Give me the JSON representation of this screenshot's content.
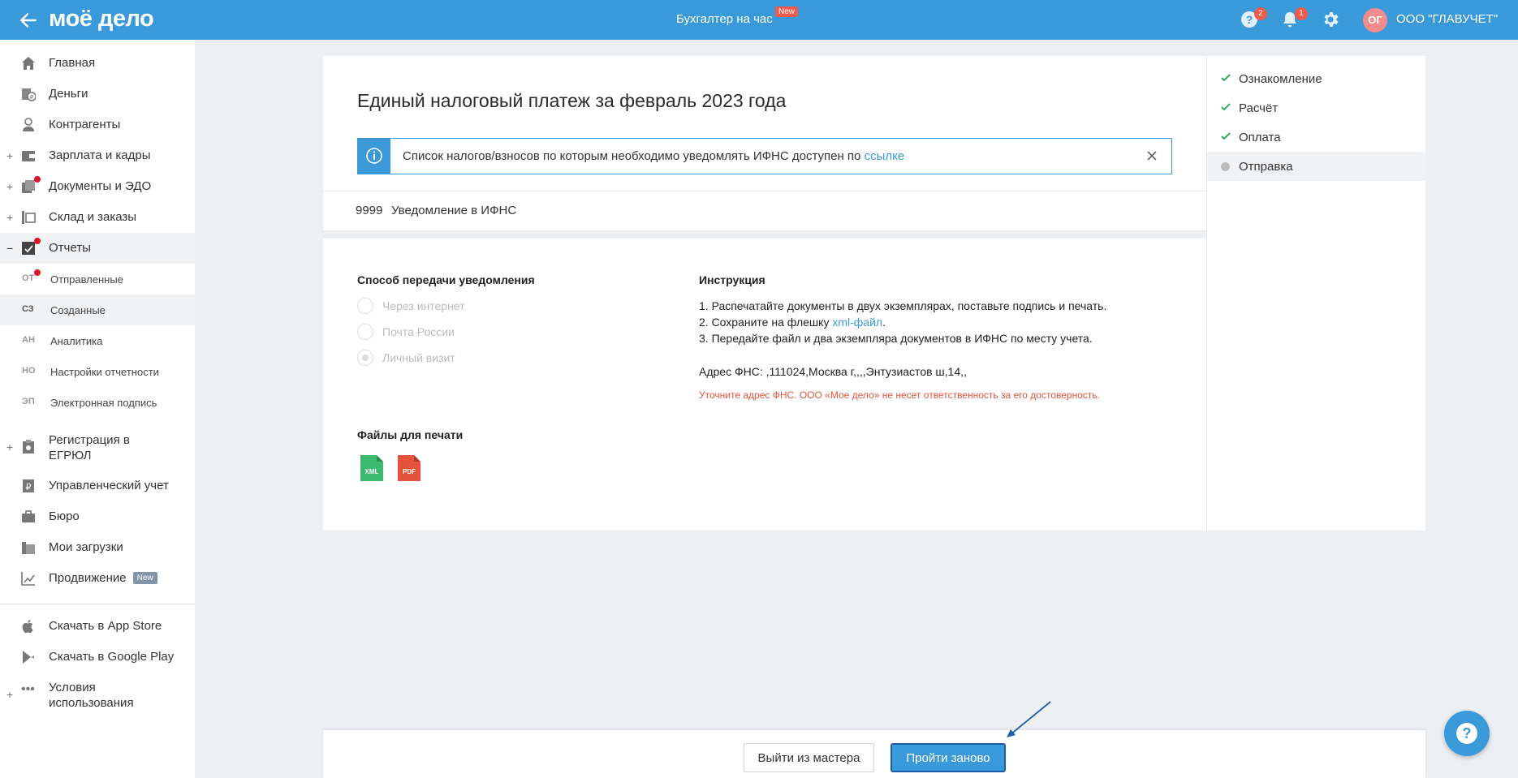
{
  "topbar": {
    "logo": "моё дело",
    "center_label": "Бухгалтер на час",
    "center_badge": "New",
    "help_count": "2",
    "notif_count": "1",
    "avatar_initials": "ОГ",
    "company": "ООО \"ГЛАВУЧЕТ\""
  },
  "sidebar": {
    "items": [
      {
        "label": "Главная"
      },
      {
        "label": "Деньги"
      },
      {
        "label": "Контрагенты"
      },
      {
        "label": "Зарплата и кадры"
      },
      {
        "label": "Документы и ЭДО"
      },
      {
        "label": "Склад и заказы"
      },
      {
        "label": "Отчеты"
      }
    ],
    "subitems": [
      {
        "abbr": "ОТ",
        "label": "Отправленные"
      },
      {
        "abbr": "СЗ",
        "label": "Созданные"
      },
      {
        "abbr": "АН",
        "label": "Аналитика"
      },
      {
        "abbr": "НО",
        "label": "Настройки отчетности"
      },
      {
        "abbr": "ЭП",
        "label": "Электронная подпись"
      }
    ],
    "items2": [
      {
        "label": "Регистрация в ЕГРЮЛ"
      },
      {
        "label": "Управленческий учет"
      },
      {
        "label": "Бюро"
      },
      {
        "label": "Мои загрузки"
      },
      {
        "label": "Продвижение",
        "badge": "New"
      }
    ],
    "items3": [
      {
        "label": "Скачать в App Store"
      },
      {
        "label": "Скачать в Google Play"
      },
      {
        "label": "Условия использования"
      }
    ]
  },
  "main": {
    "title": "Единый налоговый платеж за февраль 2023 года",
    "info_text": "Список налогов/взносов по которым необходимо уведомлять ИФНС доступен по ",
    "info_link": "ссылке",
    "code": "9999",
    "code_name": "Уведомление в ИФНС",
    "transfer_title": "Способ передачи уведомления",
    "transfer_options": [
      "Через интернет",
      "Почта России",
      "Личный визит"
    ],
    "files_title": "Файлы для печати",
    "file_xml": "XML",
    "file_pdf": "PDF",
    "instr_title": "Инструкция",
    "instr_1": "1. Распечатайте документы в двух экземплярах, поставьте подпись и печать.",
    "instr_2_pre": "2. Сохраните на флешку ",
    "instr_2_link": "xml-файл",
    "instr_2_post": ".",
    "instr_3": "3. Передайте файл и два экземпляра документов в ИФНС по месту учета.",
    "address": "Адрес ФНС: ,111024,Москва г,,,,Энтузиастов ш,14,,",
    "warning": "Уточните адрес ФНС. ООО «Мое дело» не несет ответственность за его достоверность."
  },
  "steps": [
    {
      "label": "Ознакомление",
      "done": true
    },
    {
      "label": "Расчёт",
      "done": true
    },
    {
      "label": "Оплата",
      "done": true
    },
    {
      "label": "Отправка",
      "done": false
    }
  ],
  "footer": {
    "exit_label": "Выйти из мастера",
    "restart_label": "Пройти заново"
  },
  "colors": {
    "accent": "#3a9ad9",
    "badge": "#f05a4a",
    "check": "#2eaa5c",
    "warning": "#e5533d"
  }
}
